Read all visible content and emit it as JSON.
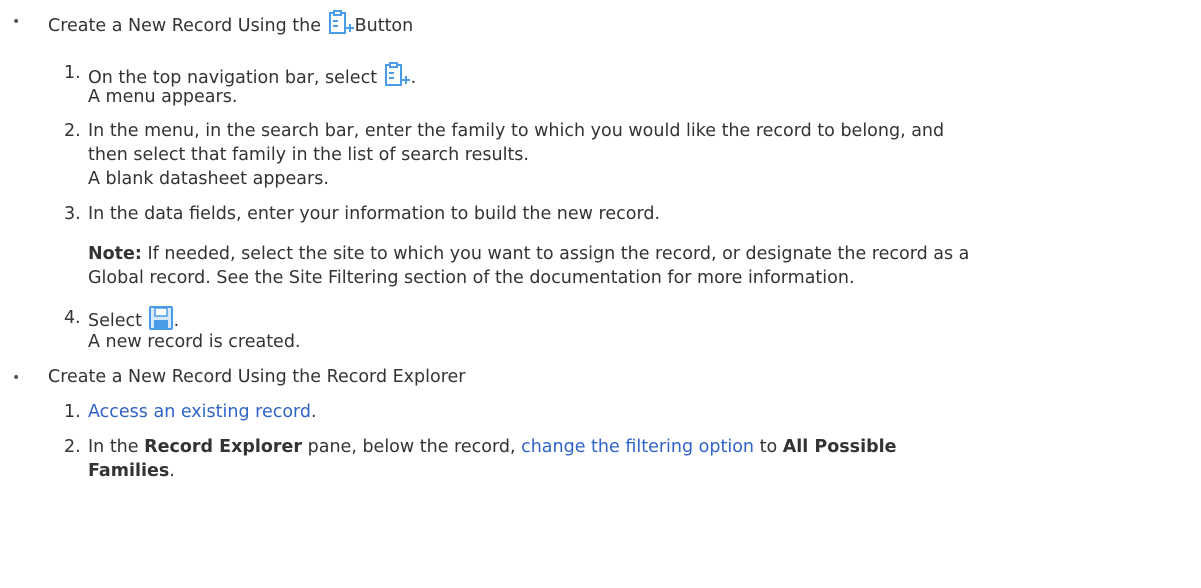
{
  "section_a": {
    "title_before": "Create a New Record Using the",
    "title_icon": "new-record-icon",
    "title_after": "Button",
    "steps": [
      {
        "num": "1.",
        "text_before": "On the top navigation bar, select",
        "icon": "new-record-icon",
        "text_after": ".",
        "result": "A menu appears."
      },
      {
        "num": "2.",
        "line1": "In the menu, in the search bar, enter the family to which you would like the record to belong, and",
        "line2": "then select that family in the list of search results.",
        "result": "A blank datasheet appears."
      },
      {
        "num": "3.",
        "text": "In the data fields, enter your information to build the new record."
      },
      {
        "num": "4.",
        "text_before": "Select",
        "icon": "save-icon",
        "text_after": ".",
        "result": "A new record is created."
      }
    ],
    "note": {
      "label": "Note:",
      "line1": "If needed, select the site to which you want to assign the record, or designate the record as a",
      "line2": "Global record. See the Site Filtering section of the documentation for more information."
    }
  },
  "section_b": {
    "title": "Create a New Record Using the Record Explorer",
    "steps": [
      {
        "num": "1.",
        "link": "Access an existing record",
        "text_after": "."
      },
      {
        "num": "2.",
        "text_before": "In the",
        "bold1": "Record Explorer",
        "text_mid": "pane, below the record,",
        "link": "change the filtering option",
        "text_mid2": "to",
        "bold2_line1": "All Possible",
        "bold2_line2": "Families",
        "text_after": "."
      }
    ]
  },
  "colors": {
    "text": "#333333",
    "link": "#2f63c6",
    "icon": "#4a9be8"
  }
}
